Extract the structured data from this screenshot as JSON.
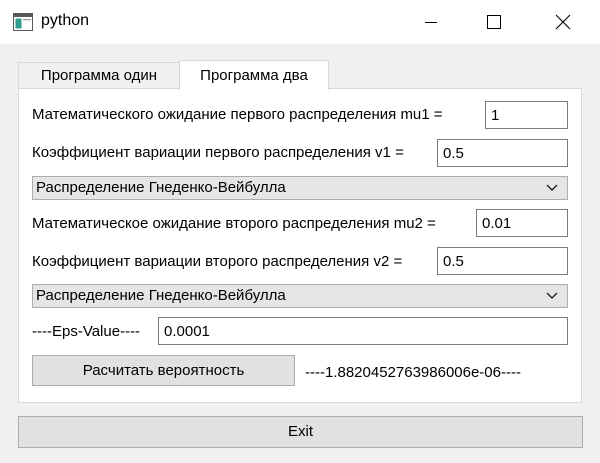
{
  "window": {
    "title": "python",
    "icons": {
      "app": "python-window-icon",
      "minimize": "minimize-icon",
      "maximize": "maximize-icon",
      "close": "close-icon"
    }
  },
  "tabs": [
    {
      "label": "Программа один",
      "active": false
    },
    {
      "label": "Программа два",
      "active": true
    }
  ],
  "form": {
    "mu1_label": "Математического ожидание первого распределения mu1 =",
    "mu1_value": "1",
    "v1_label": "Коэффициент вариации первого распределения v1 =",
    "v1_value": "0.5",
    "dist1_selected": "Распределение Гнеденко-Вейбулла",
    "mu2_label": "Математическое ожидание второго распределения mu2 =",
    "mu2_value": "0.01",
    "v2_label": "Коэффициент вариации второго распределения v2 =",
    "v2_value": "0.5",
    "dist2_selected": "Распределение Гнеденко-Вейбулла",
    "eps_label": "----Eps-Value----",
    "eps_value": "0.0001",
    "calc_button": "Расчитать вероятность",
    "result": "----1.8820452763986006e-06----"
  },
  "exit_button": "Exit",
  "colors": {
    "titlebar": "#ffffff",
    "background": "#f0f0f0",
    "panel": "#ffffff",
    "button": "#e1e1e1",
    "combo": "#e5e5e5",
    "border": "#adadad"
  }
}
